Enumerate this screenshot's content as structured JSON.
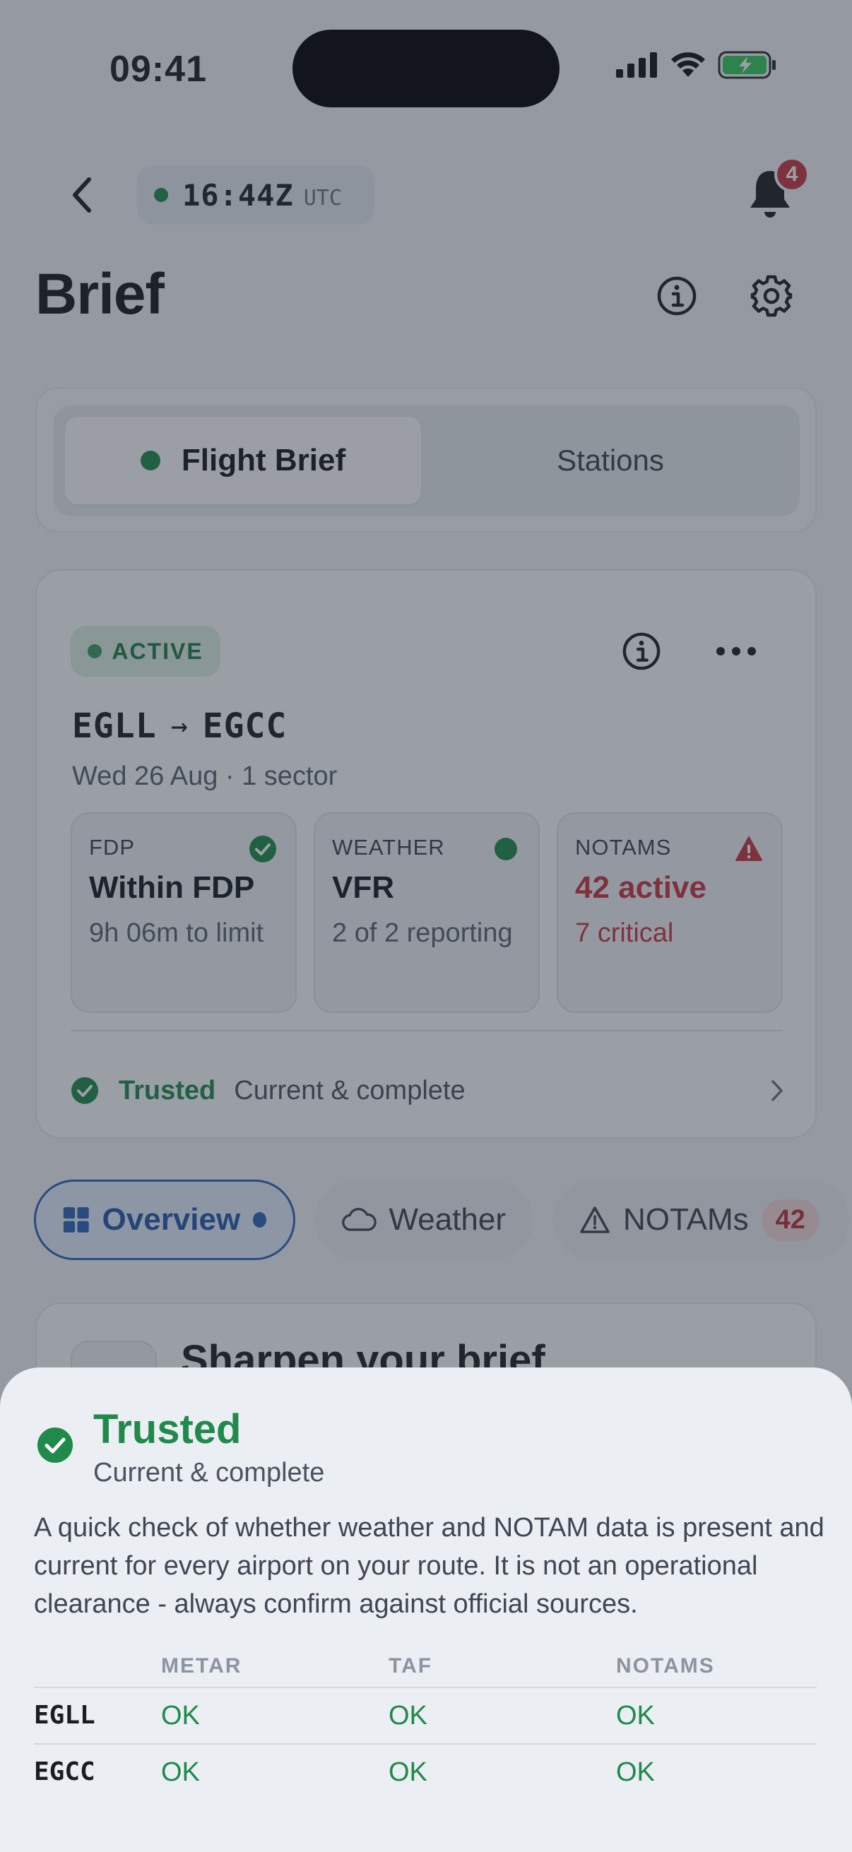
{
  "status_bar": {
    "time": "09:41"
  },
  "header": {
    "utc_time": "16:44Z",
    "utc_label": "UTC",
    "notification_count": "4",
    "title": "Brief"
  },
  "segmented": {
    "active": "Flight Brief",
    "other": "Stations"
  },
  "brief_card": {
    "status": "ACTIVE",
    "origin": "EGLL",
    "arrow": "→",
    "destination": "EGCC",
    "subtitle": "Wed 26 Aug · 1 sector",
    "tiles": [
      {
        "label": "FDP",
        "main": "Within FDP",
        "sub": "9h 06m to limit",
        "icon": "check-circle-icon"
      },
      {
        "label": "WEATHER",
        "main": "VFR",
        "sub": "2 of 2 reporting",
        "icon": "status-dot-icon"
      },
      {
        "label": "NOTAMS",
        "main": "42 active",
        "sub": "7 critical",
        "icon": "warning-triangle-icon"
      }
    ],
    "trust_label": "Trusted",
    "trust_detail": "Current & complete"
  },
  "chips": {
    "overview": "Overview",
    "weather": "Weather",
    "notams": "NOTAMs",
    "notams_count": "42"
  },
  "sharpen_card": {
    "title": "Sharpen your brief"
  },
  "sheet": {
    "title": "Trusted",
    "subtitle": "Current & complete",
    "body": "A quick check of whether weather and NOTAM data is present and current for every airport on your route. It is not an operational clearance - always confirm against official sources.",
    "columns": [
      "METAR",
      "TAF",
      "NOTAMS"
    ],
    "rows": [
      {
        "code": "EGLL",
        "values": [
          "OK",
          "OK",
          "OK"
        ]
      },
      {
        "code": "EGCC",
        "values": [
          "OK",
          "OK",
          "OK"
        ]
      }
    ]
  },
  "colors": {
    "ok_green": "#1f8a4a",
    "alert_red": "#c7343d",
    "accent_blue": "#2d63b8"
  }
}
